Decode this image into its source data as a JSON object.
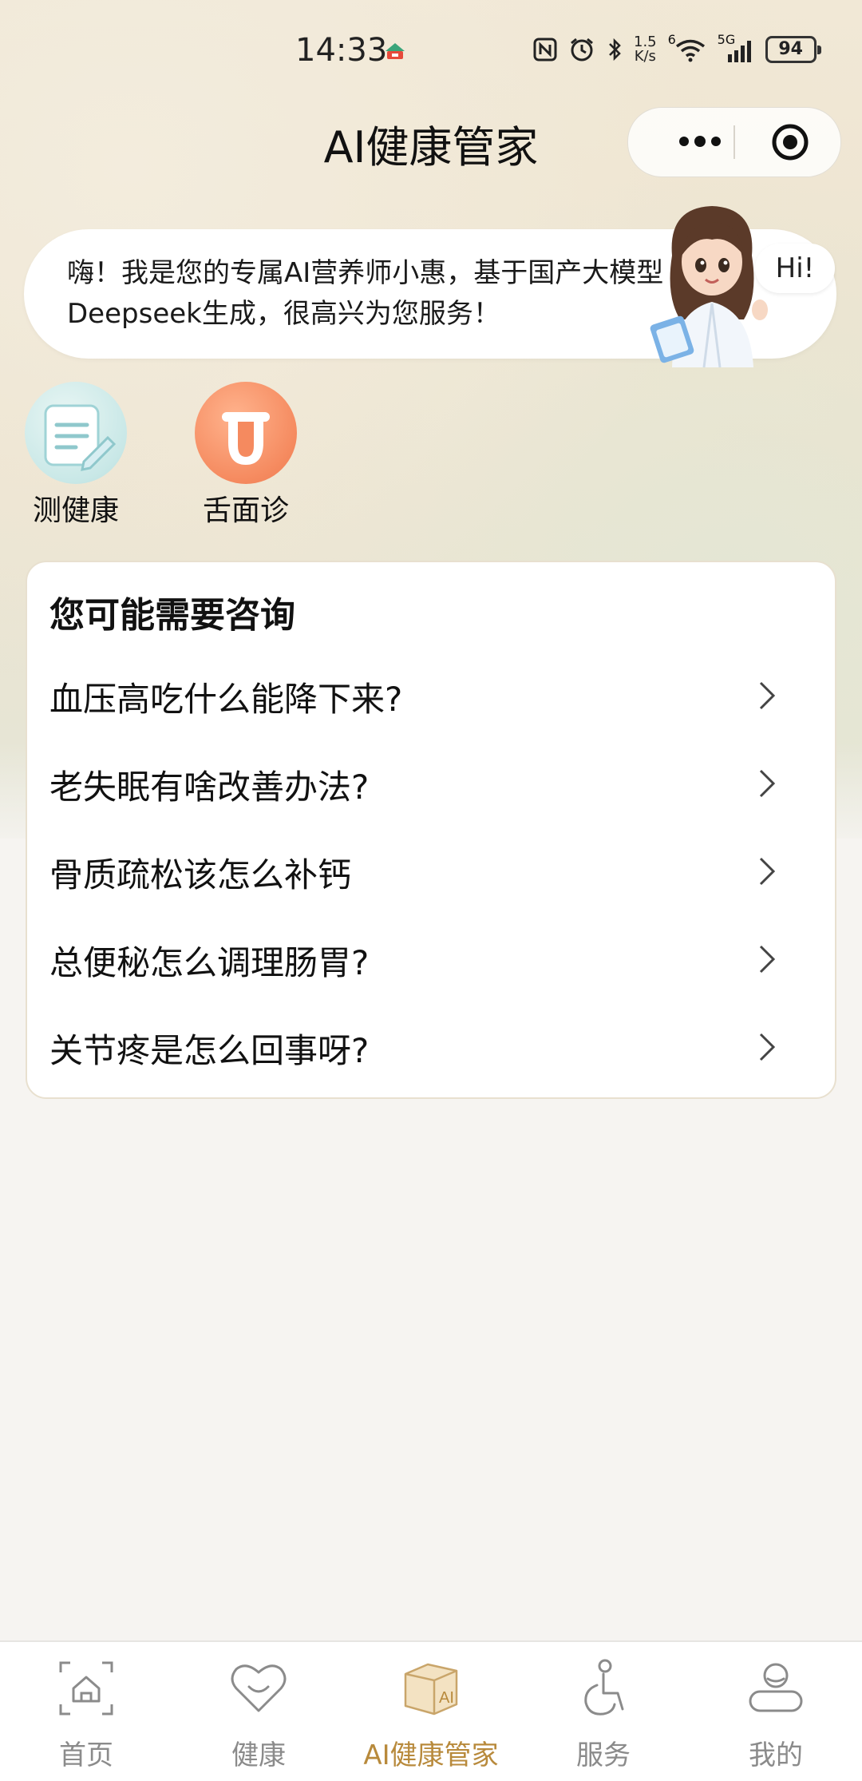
{
  "status_bar": {
    "time": "14:33",
    "net_speed_top": "1.5",
    "net_speed_bottom": "K/s",
    "signal_label": "5G",
    "sim_label": "6",
    "battery": "94"
  },
  "header": {
    "title": "AI健康管家"
  },
  "greeting": {
    "text": "嗨！我是您的专属AI营养师小惠，基于国产大模型Deepseek生成，很高兴为您服务！",
    "hi_bubble": "Hi!"
  },
  "tools": [
    {
      "label": "测健康",
      "icon": "health-test-icon"
    },
    {
      "label": "舌面诊",
      "icon": "tongue-diagnosis-icon"
    }
  ],
  "suggestions": {
    "title": "您可能需要咨询",
    "items": [
      "血压高吃什么能降下来?",
      "老失眠有啥改善办法?",
      "骨质疏松该怎么补钙",
      "总便秘怎么调理肠胃?",
      "关节疼是怎么回事呀?"
    ]
  },
  "tabbar": {
    "items": [
      {
        "label": "首页",
        "icon": "home-icon"
      },
      {
        "label": "健康",
        "icon": "heart-icon"
      },
      {
        "label": "AI健康管家",
        "icon": "ai-box-icon"
      },
      {
        "label": "服务",
        "icon": "accessibility-icon"
      },
      {
        "label": "我的",
        "icon": "profile-icon"
      }
    ],
    "active_index": 2,
    "active_color": "#b88a3c",
    "inactive_color": "#8b8b8b"
  },
  "colors": {
    "accent": "#b88a3c",
    "tongue_orange": "#f58a5f",
    "health_teal": "#c9e8e7"
  }
}
